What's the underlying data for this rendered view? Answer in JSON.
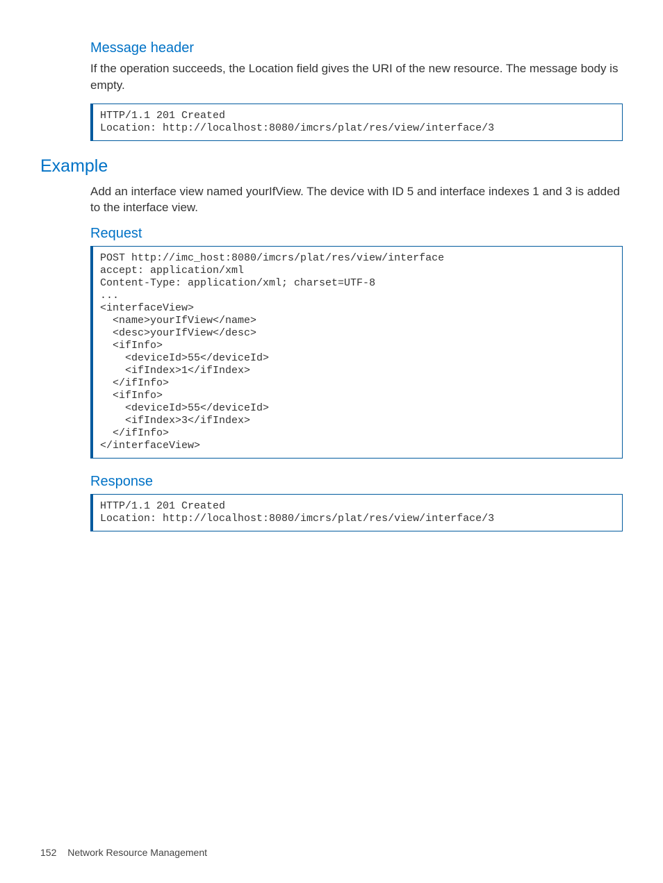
{
  "section1": {
    "heading": "Message header",
    "body": "If the operation succeeds, the Location field gives the URI of the new resource. The message body is empty.",
    "code": "HTTP/1.1 201 Created\nLocation: http://localhost:8080/imcrs/plat/res/view/interface/3"
  },
  "section2": {
    "heading": "Example",
    "body": "Add an interface view named yourIfView. The device with ID 5 and interface indexes 1 and 3 is added to the interface view."
  },
  "request": {
    "heading": "Request",
    "code": "POST http://imc_host:8080/imcrs/plat/res/view/interface\naccept: application/xml\nContent-Type: application/xml; charset=UTF-8\n...\n<interfaceView>\n  <name>yourIfView</name>\n  <desc>yourIfView</desc>\n  <ifInfo>\n    <deviceId>55</deviceId>\n    <ifIndex>1</ifIndex>\n  </ifInfo>\n  <ifInfo>\n    <deviceId>55</deviceId>\n    <ifIndex>3</ifIndex>\n  </ifInfo>\n</interfaceView>"
  },
  "response": {
    "heading": "Response",
    "code": "HTTP/1.1 201 Created\nLocation: http://localhost:8080/imcrs/plat/res/view/interface/3"
  },
  "footer": {
    "page": "152",
    "title": "Network Resource Management"
  }
}
